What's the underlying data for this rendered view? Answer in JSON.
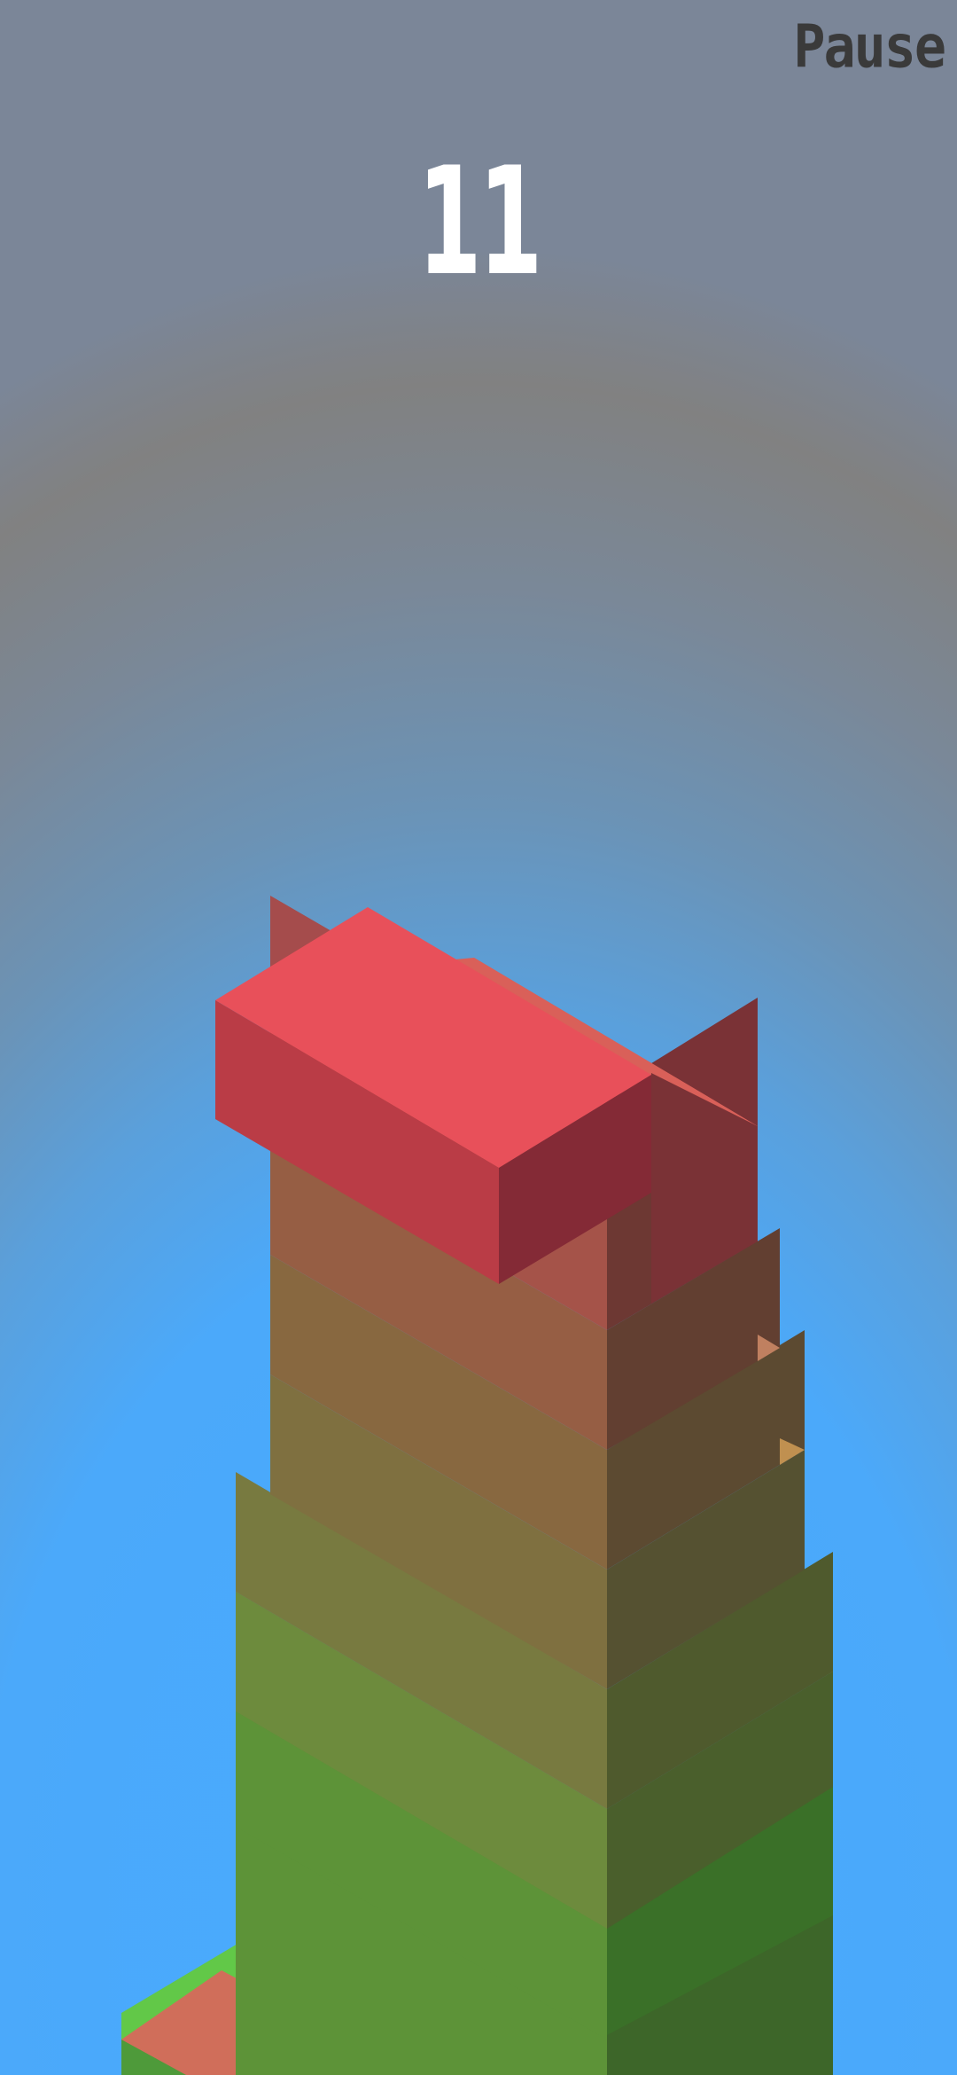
{
  "hud": {
    "pause_label": "Pause",
    "score": "11"
  },
  "colors": {
    "sky_top": "#818181",
    "sky_bottom": "#48aaff",
    "score_text": "#ffffff",
    "pause_text": "#3a3a3a"
  },
  "stack": {
    "placed_blocks": 11,
    "layers": [
      {
        "top": "#62c848",
        "left": "#4e9a3a",
        "right": "#3a7028",
        "sliced": "#d06e5a"
      },
      {
        "top": "#5a9038",
        "left": "#5d9338",
        "right": "#3d6629"
      },
      {
        "top": "#6d8b3d",
        "left": "#6d8b3d",
        "right": "#4a5f2c"
      },
      {
        "top": "#b0a050",
        "left": "#787a40",
        "right": "#4f5a2d"
      },
      {
        "top": "#a0a050",
        "left": "#7f7040",
        "right": "#555131"
      },
      {
        "top": "#c09050",
        "left": "#886840",
        "right": "#5c4a31"
      },
      {
        "top": "#c08060",
        "left": "#965e44",
        "right": "#623f31"
      },
      {
        "top": "#d07060",
        "left": "#a55349",
        "right": "#6d3833"
      },
      {
        "top": "#d96059",
        "left": "#a54c4c",
        "right": "#7a3236"
      }
    ],
    "moving_block": {
      "top": "#e8505a",
      "left": "#ba3c46",
      "right": "#842a36"
    }
  }
}
